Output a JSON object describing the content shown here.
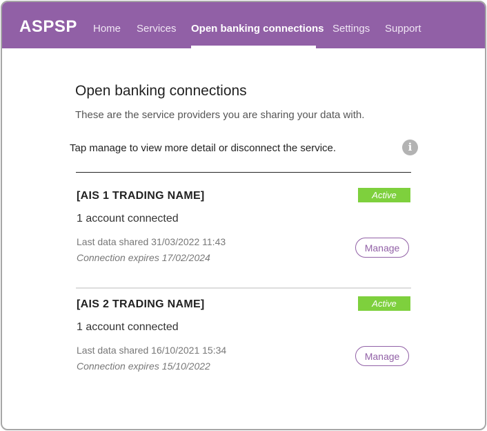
{
  "header": {
    "brand": "ASPSP",
    "nav": [
      {
        "label": "Home"
      },
      {
        "label": "Services"
      },
      {
        "label": "Open banking connections"
      },
      {
        "label": "Settings"
      },
      {
        "label": "Support"
      }
    ],
    "active_nav": "Open banking connections",
    "background_color": "#9160a6"
  },
  "page": {
    "title": "Open banking connections",
    "subtitle": "These are the service providers you are sharing your data with.",
    "hint": "Tap manage to view more detail or disconnect the service.",
    "info_icon": "info-icon"
  },
  "connections": [
    {
      "name": "[AIS 1 TRADING NAME]",
      "status": "Active",
      "accounts": "1 account connected",
      "last_shared": "Last data shared 31/03/2022 11:43",
      "expires": "Connection expires 17/02/2024",
      "button_label": "Manage"
    },
    {
      "name": "[AIS 2 TRADING NAME]",
      "status": "Active",
      "accounts": "1 account connected",
      "last_shared": "Last data shared 16/10/2021 15:34",
      "expires": "Connection expires 15/10/2022",
      "button_label": "Manage"
    }
  ],
  "colors": {
    "accent": "#9160a6",
    "status_active": "#7ed03d"
  }
}
